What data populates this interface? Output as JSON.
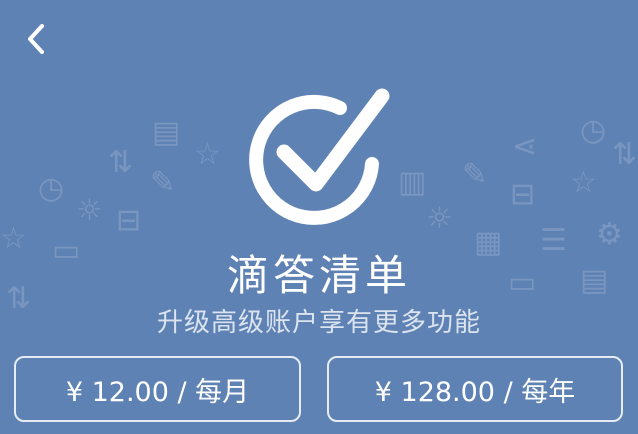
{
  "header": {
    "back_icon": "chevron-left-icon"
  },
  "app": {
    "logo_icon": "check-circle-icon",
    "title": "滴答清单",
    "subtitle": "升级高级账户享有更多功能"
  },
  "plans": [
    {
      "label": "¥ 12.00 / 每月"
    },
    {
      "label": "¥ 128.00 / 每年"
    }
  ],
  "colors": {
    "background": "#5f82b4",
    "foreground": "#ffffff"
  },
  "background_icons": [
    "document-icon",
    "clock-icon",
    "star-icon",
    "pencil-icon",
    "sun-icon",
    "inbox-icon",
    "calendar-icon",
    "trash-icon",
    "share-icon",
    "card-icon",
    "list-icon",
    "gear-icon",
    "sort-icon"
  ]
}
